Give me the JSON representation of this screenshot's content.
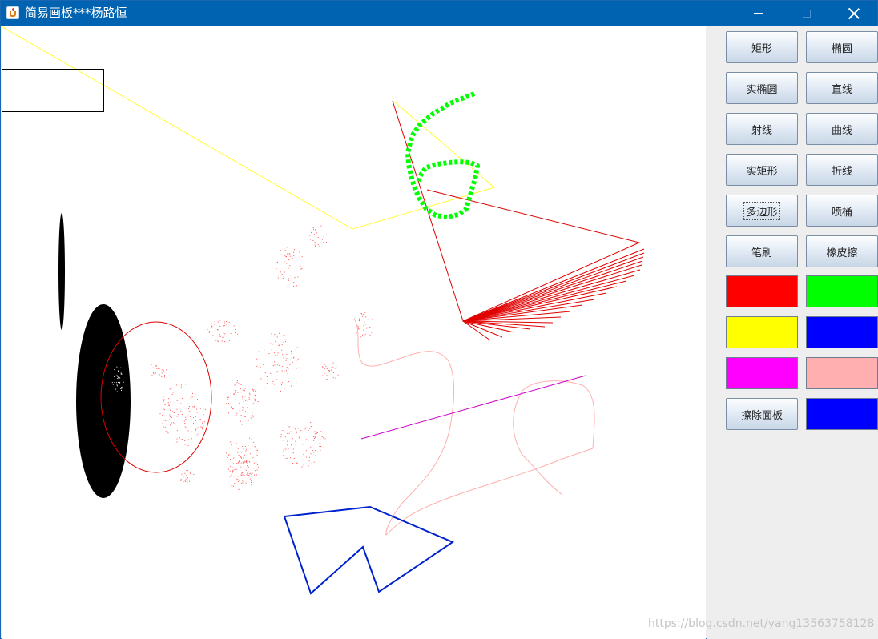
{
  "window": {
    "title": "简易画板***杨路恒"
  },
  "toolbar": {
    "tools": [
      {
        "label": "矩形"
      },
      {
        "label": "椭圆"
      },
      {
        "label": "实椭圆"
      },
      {
        "label": "直线"
      },
      {
        "label": "射线"
      },
      {
        "label": "曲线"
      },
      {
        "label": "实矩形"
      },
      {
        "label": "折线"
      },
      {
        "label": "多边形"
      },
      {
        "label": "喷桶"
      },
      {
        "label": "笔刷"
      },
      {
        "label": "橡皮擦"
      }
    ],
    "focused_tool": "多边形",
    "colors": [
      "#ff0000",
      "#00ff00",
      "#ffff00",
      "#0000ff",
      "#ff00ff",
      "#ffafaf"
    ],
    "clear_label": "擦除面板",
    "current_color": "#0000ff"
  },
  "watermark": "https://blog.csdn.net/yang13563758128"
}
